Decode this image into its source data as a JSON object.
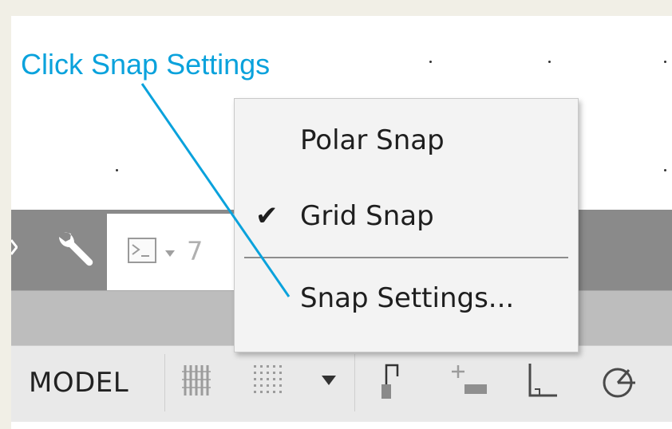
{
  "callout": {
    "text": "Click Snap Settings"
  },
  "command_line": {
    "settings_icon": "wrench-icon",
    "prompt_icon": "command-prompt-icon",
    "dropdown_icon": "chevron-down-icon",
    "partial_text": "7"
  },
  "menu": {
    "items": [
      {
        "label": "Polar Snap",
        "checked": false
      },
      {
        "label": "Grid Snap",
        "checked": true
      },
      {
        "label": "Snap Settings...",
        "checked": false
      }
    ],
    "check_glyph": "✔"
  },
  "status_bar": {
    "model_label": "MODEL",
    "icons": [
      "grid-display-icon",
      "snap-mode-icon",
      "snap-dropdown-icon",
      "infer-constraints-icon",
      "dynamic-input-icon",
      "ortho-mode-icon",
      "polar-tracking-icon"
    ]
  },
  "colors": {
    "callout": "#0aa2dc",
    "command_bar": "#8a8a8a",
    "menu_background": "#f3f3f3",
    "status_bar": "#e9e9e9",
    "page_background": "#f1efe6"
  }
}
